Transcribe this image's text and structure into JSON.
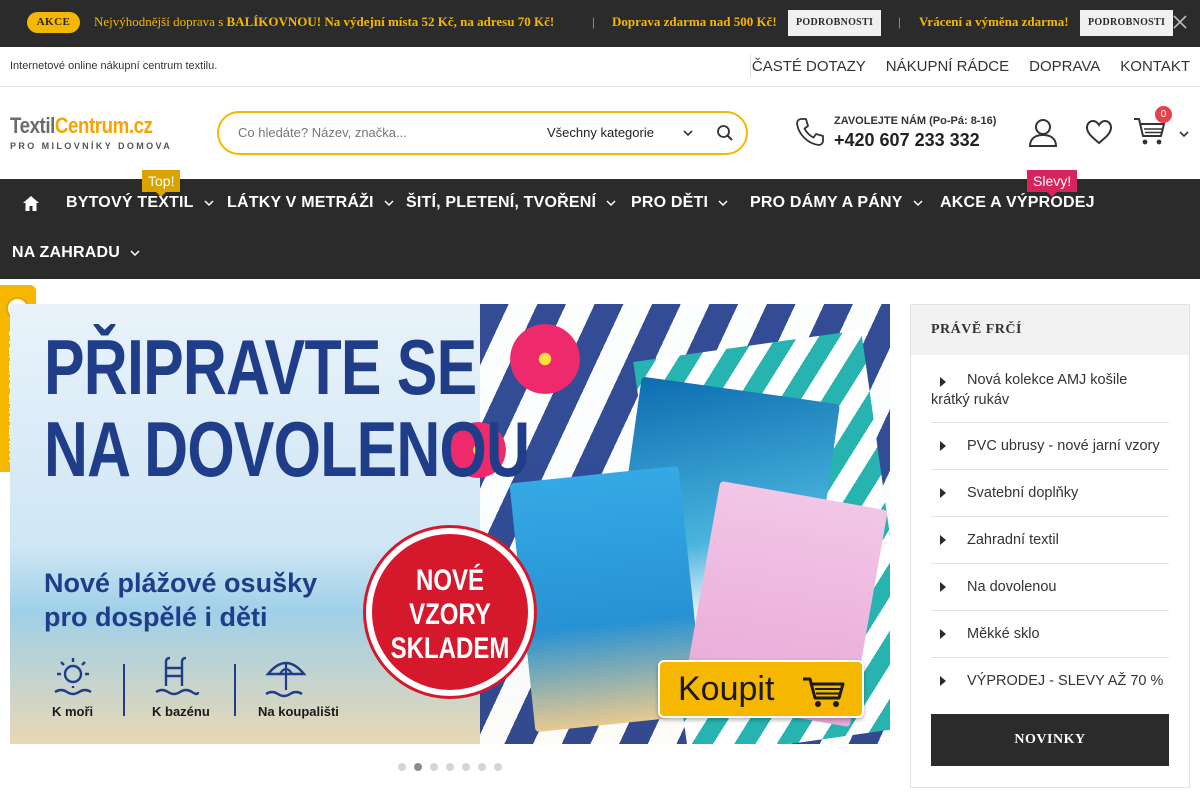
{
  "promo": {
    "akce": "AKCE",
    "msg1_pre": "Nejvýhodnější doprava s ",
    "msg1_brand": "BALÍKOVNOU!",
    "msg1_post": " Na výdejní místa 52 Kč, na adresu 70 Kč!",
    "sep": "|",
    "msg2": "Doprava zdarma nad 500 Kč!",
    "details": "PODROBNOSTI",
    "msg3": "Vrácení a výměna zdarma!"
  },
  "topbar": {
    "tagline": "Internetové online nákupní centrum textilu.",
    "links": [
      "ČASTÉ DOTAZY",
      "NÁKUPNÍ RÁDCE",
      "DOPRAVA",
      "KONTAKT"
    ]
  },
  "logo": {
    "part1": "Textil",
    "part2": "Centrum",
    "part3": ".cz",
    "slogan": "PRO MILOVNÍKY DOMOVA"
  },
  "search": {
    "placeholder": "Co hledáte? Název, značka...",
    "category": "Všechny kategorie"
  },
  "contact": {
    "label": "ZAVOLEJTE NÁM (Po-Pá: 8-16)",
    "phone": "+420 607 233 332"
  },
  "cart": {
    "count": "0"
  },
  "nav": {
    "items": [
      "BYTOVÝ TEXTIL",
      "LÁTKY V METRÁŽI",
      "ŠITÍ, PLETENÍ, TVOŘENÍ",
      "PRO DĚTI",
      "PRO DÁMY A PÁNY",
      "AKCE A VÝPRODEJ",
      "NA ZAHRADU"
    ],
    "badge_top": "Top!",
    "badge_sale": "Slevy!"
  },
  "verify": {
    "label": "OVĚŘENO ZÁKAZNÍKY"
  },
  "hero": {
    "headline_1": "PŘIPRAVTE SE",
    "headline_2": "NA DOVOLENOU",
    "sub_1": "Nové plážové osušky",
    "sub_2": "pro dospělé i děti",
    "seal_1": "NOVÉ",
    "seal_2": "VZORY",
    "seal_3": "SKLADEM",
    "icons": [
      "K moři",
      "K bazénu",
      "Na koupališti"
    ],
    "buy": "Koupit",
    "slides_total": 7,
    "active_slide": 2
  },
  "panel": {
    "title": "PRÁVĚ FRČÍ",
    "items": [
      "Nová kolekce AMJ košile krátký rukáv",
      "PVC ubrusy - nové jarní vzory",
      "Svatební doplňky",
      "Zahradní textil",
      "Na dovolenou",
      "Měkké sklo",
      "VÝPRODEJ - SLEVY AŽ 70 %"
    ],
    "button": "NOVINKY"
  },
  "colors": {
    "accent": "#f5b700",
    "dark": "#2b2b2b",
    "sale": "#d6245c",
    "brand_blue": "#1f3d88"
  }
}
